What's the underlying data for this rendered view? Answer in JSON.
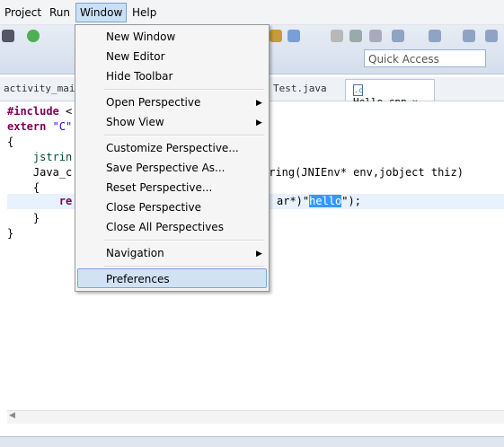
{
  "menubar": {
    "items": [
      "Project",
      "Run",
      "Window",
      "Help"
    ]
  },
  "toolbar": {
    "quick_access_placeholder": "Quick Access"
  },
  "tabs": {
    "left": "activity_main.",
    "middle": "Test.java",
    "active": "Hello.cpp",
    "active_icon": ".c"
  },
  "editor": {
    "line1a": "#include",
    "line1b": " <",
    "line2a": "extern",
    "line2b": " \"C\"",
    "line3": "{",
    "line4": "    jstrin",
    "line5a": "    Java_c",
    "line5b": "tring(JNIEnv* env,jobject thiz)",
    "line6": "    {",
    "line7a": "        re",
    "line7b": "ar*)\"",
    "line7sel": "hello",
    "line7c": "\");",
    "line8": "    }",
    "line9": "}"
  },
  "window_menu": {
    "items": [
      "New Window",
      "New Editor",
      "Hide Toolbar",
      "Open Perspective",
      "Show View",
      "Customize Perspective...",
      "Save Perspective As...",
      "Reset Perspective...",
      "Close Perspective",
      "Close All Perspectives",
      "Navigation",
      "Preferences"
    ],
    "submenu_arrow": "▶"
  },
  "colors": {
    "highlight": "#d1e2f2",
    "selection": "#3399ff",
    "keyword": "#7f0055"
  }
}
